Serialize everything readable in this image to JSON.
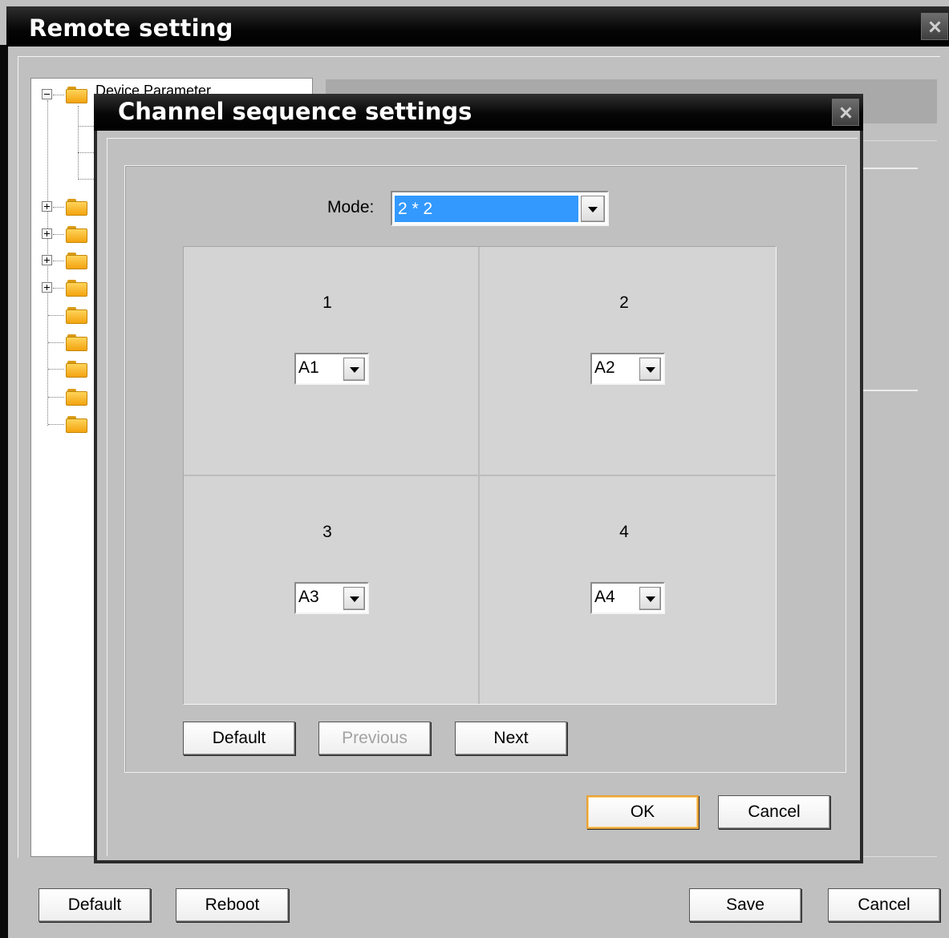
{
  "outer_window": {
    "title": "Remote setting",
    "close_icon": "close-icon",
    "tree": {
      "root_label": "Device Parameter",
      "icons": [
        "minus-expander-icon",
        "plus-expander-icon",
        "folder-icon"
      ]
    },
    "bottom_buttons": {
      "default_label": "Default",
      "reboot_label": "Reboot",
      "save_label": "Save",
      "cancel_label": "Cancel"
    }
  },
  "dialog": {
    "title": "Channel sequence settings",
    "close_icon": "close-icon",
    "mode_label": "Mode:",
    "mode_value": "2 * 2",
    "cells": [
      {
        "number": "1",
        "channel": "A1"
      },
      {
        "number": "2",
        "channel": "A2"
      },
      {
        "number": "3",
        "channel": "A3"
      },
      {
        "number": "4",
        "channel": "A4"
      }
    ],
    "buttons": {
      "default_label": "Default",
      "previous_label": "Previous",
      "next_label": "Next",
      "ok_label": "OK",
      "cancel_label": "Cancel"
    },
    "colors": {
      "title_bar": "#000000",
      "selection": "#3399ff",
      "panel": "#c0c0c0",
      "focus_border": "#e8a23a"
    }
  }
}
